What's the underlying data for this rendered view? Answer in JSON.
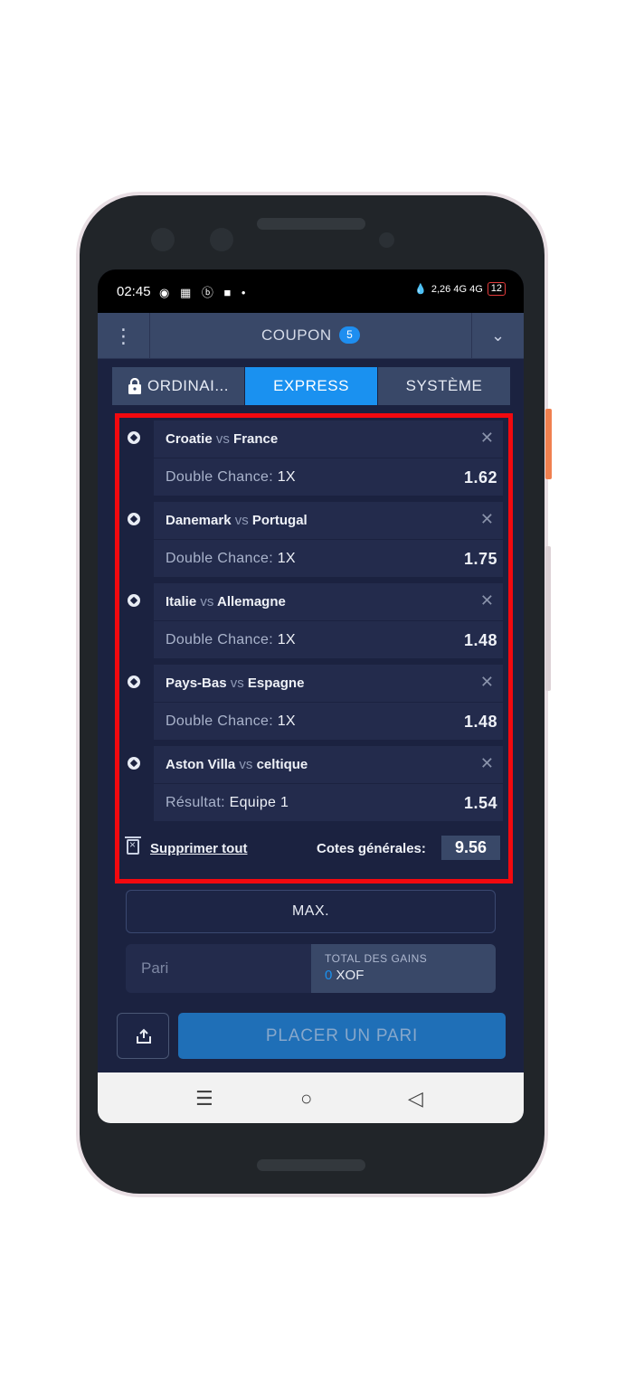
{
  "status_bar": {
    "time": "02:45",
    "left_icons": "◉ ▦ ⓑ ■ •",
    "network": "2,26 4G 4G",
    "battery": "12"
  },
  "header": {
    "title": "COUPON",
    "badge": "5"
  },
  "tabs": [
    {
      "label": "ORDINAI...",
      "icon": "lock-icon",
      "active": false
    },
    {
      "label": "EXPRESS",
      "active": true
    },
    {
      "label": "SYSTÈME",
      "active": false
    }
  ],
  "bets": [
    {
      "home": "Croatie",
      "vs": "vs",
      "away": "France",
      "market": "Double Chance:",
      "selection": "1X",
      "odds": "1.62"
    },
    {
      "home": "Danemark",
      "vs": "vs",
      "away": "Portugal",
      "market": "Double Chance:",
      "selection": "1X",
      "odds": "1.75"
    },
    {
      "home": "Italie",
      "vs": "vs",
      "away": "Allemagne",
      "market": "Double Chance:",
      "selection": "1X",
      "odds": "1.48"
    },
    {
      "home": "Pays-Bas",
      "vs": "vs",
      "away": "Espagne",
      "market": "Double Chance:",
      "selection": "1X",
      "odds": "1.48"
    },
    {
      "home": "Aston Villa",
      "vs": "vs",
      "away": "celtique",
      "market": "Résultat:",
      "selection": "Equipe 1",
      "odds": "1.54"
    }
  ],
  "footer": {
    "delete_all": "Supprimer tout",
    "total_label": "Cotes générales:",
    "total_odds": "9.56"
  },
  "max_button": "MAX.",
  "stake": {
    "placeholder": "Pari",
    "gains_label": "TOTAL DES GAINS",
    "gains_value": "0",
    "currency": "XOF"
  },
  "place_bet": "PLACER UN PARI",
  "colors": {
    "accent": "#1a91f0",
    "highlight": "#f2090f",
    "background": "#1b2240"
  }
}
